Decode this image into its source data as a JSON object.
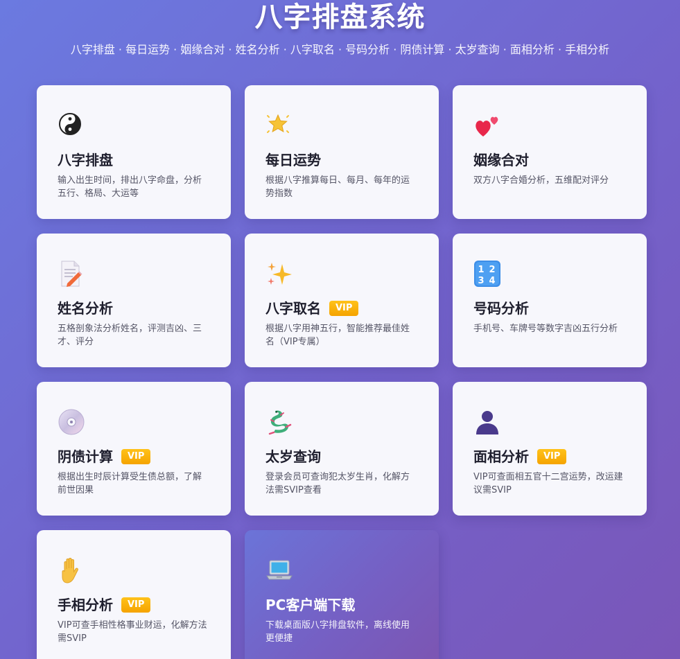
{
  "header": {
    "title": "八字排盘系统",
    "subtitle": "八字排盘 · 每日运势 · 姻缘合对 · 姓名分析 · 八字取名 · 号码分析 · 阴债计算 · 太岁查询 · 面相分析 · 手相分析"
  },
  "cards": [
    {
      "icon": "yin-yang-icon",
      "title": "八字排盘",
      "vip": "",
      "desc": "输入出生时间，排出八字命盘，分析五行、格局、大运等"
    },
    {
      "icon": "star-icon",
      "title": "每日运势",
      "vip": "",
      "desc": "根据八字推算每日、每月、每年的运势指数"
    },
    {
      "icon": "two-hearts-icon",
      "title": "姻缘合对",
      "vip": "",
      "desc": "双方八字合婚分析，五维配对评分"
    },
    {
      "icon": "memo-pencil-icon",
      "title": "姓名分析",
      "vip": "",
      "desc": "五格剖象法分析姓名，评测吉凶、三才、评分"
    },
    {
      "icon": "sparkles-icon",
      "title": "八字取名",
      "vip": "VIP",
      "desc": "根据八字用神五行，智能推荐最佳姓名（VIP专属）"
    },
    {
      "icon": "number-keycap-icon",
      "title": "号码分析",
      "vip": "",
      "desc": "手机号、车牌号等数字吉凶五行分析"
    },
    {
      "icon": "disc-icon",
      "title": "阴债计算",
      "vip": "VIP",
      "desc": "根据出生时辰计算受生债总额，了解前世因果"
    },
    {
      "icon": "dragon-icon",
      "title": "太岁查询",
      "vip": "",
      "desc": "登录会员可查询犯太岁生肖，化解方法需SVIP查看"
    },
    {
      "icon": "person-silhouette-icon",
      "title": "面相分析",
      "vip": "VIP",
      "desc": "VIP可查面相五官十二宫运势，改运建议需SVIP"
    },
    {
      "icon": "raised-hand-icon",
      "title": "手相分析",
      "vip": "VIP",
      "desc": "VIP可查手相性格事业财运，化解方法需SVIP"
    },
    {
      "icon": "laptop-icon",
      "title": "PC客户端下载",
      "vip": "",
      "desc": "下载桌面版八字排盘软件，离线使用更便捷"
    }
  ],
  "colors": {
    "background_start": "#6b7ae0",
    "background_end": "#7a56b8",
    "card_bg": "#f7f7fc",
    "vip_badge": "#f5a300",
    "title_text": "#1f1f2e"
  }
}
